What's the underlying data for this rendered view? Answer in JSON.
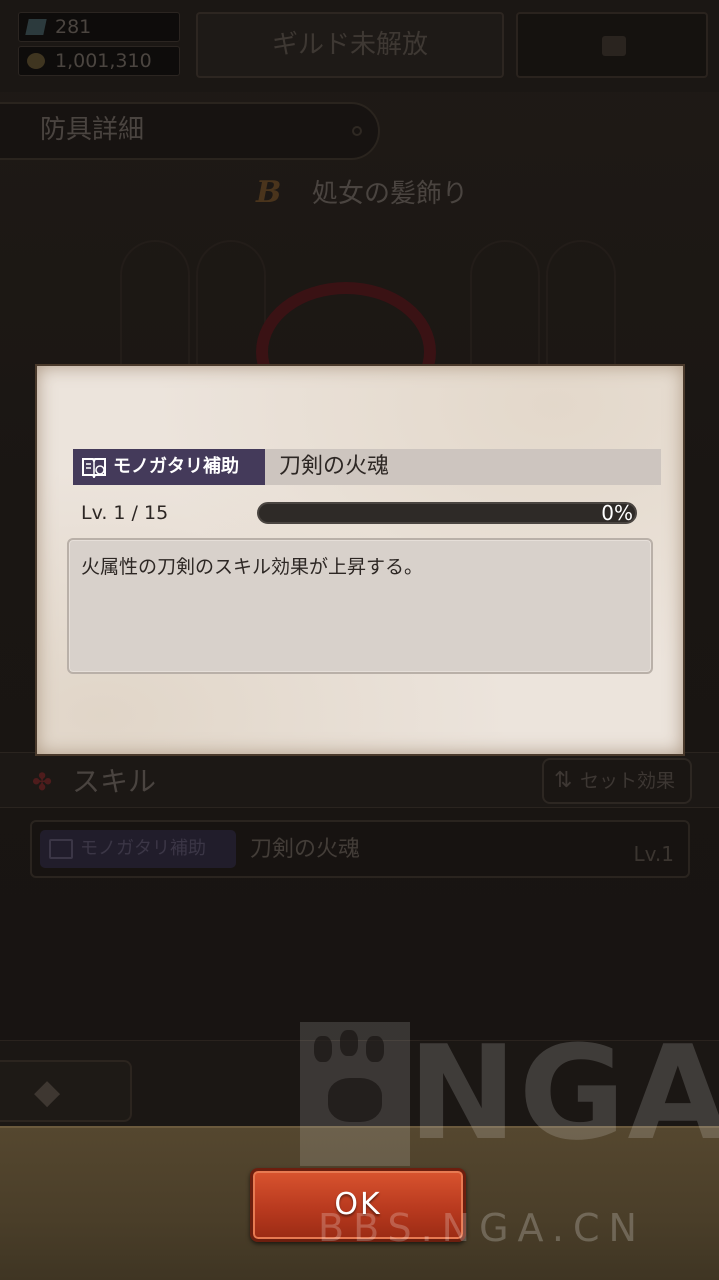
{
  "header": {
    "gems": "281",
    "gold": "1,001,310",
    "guild_button": "ギルド未解放",
    "lock_icon": "lock-icon"
  },
  "armor": {
    "section_title": "防具詳細",
    "rank": "B",
    "item_name": "処女の髪飾り"
  },
  "skills": {
    "header": "スキル",
    "set_effect_button": "セット効果",
    "row": {
      "type_label": "モノガタリ補助",
      "name": "刀剣の火魂",
      "level": "Lv.1"
    }
  },
  "modal": {
    "type_label": "モノガタリ補助",
    "skill_name": "刀剣の火魂",
    "level": "Lv. 1 / 15",
    "progress": 0,
    "progress_text": "0%",
    "description": "火属性の刀剣のスキル効果が上昇する。",
    "book_icon": "book-icon"
  },
  "ok_button": "OK",
  "watermark": {
    "text": "NGA",
    "url": "BBS.NGA.CN"
  },
  "colors": {
    "tag_purple": "#443a5a",
    "ok_red": "#c8401f",
    "parchment": "#ece4dc"
  }
}
